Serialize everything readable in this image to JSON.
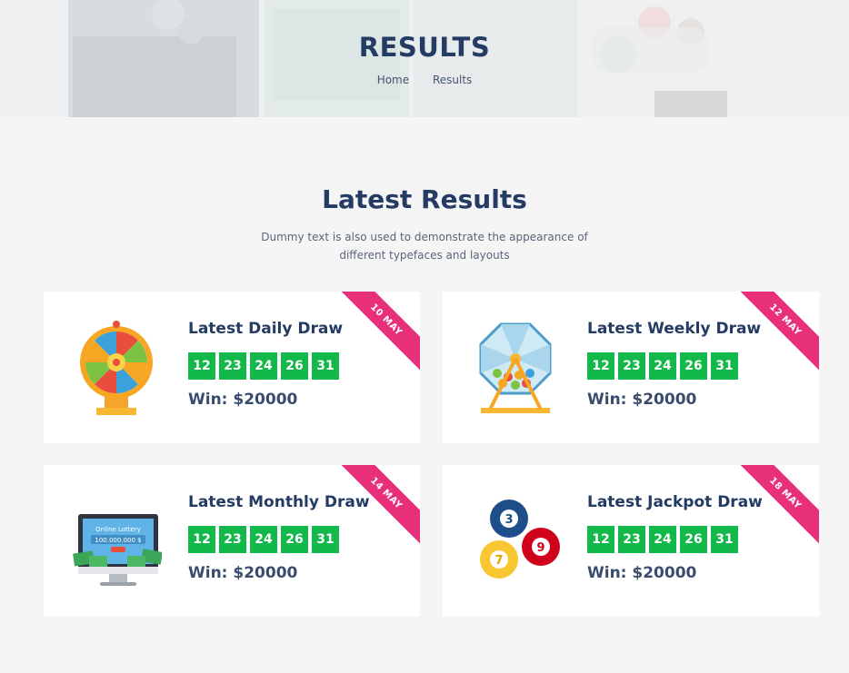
{
  "banner": {
    "title": "RESULTS",
    "breadcrumb": [
      "Home",
      "Results"
    ]
  },
  "section": {
    "title": "Latest Results",
    "description": "Dummy text is also used to demonstrate the appearance of different typefaces and layouts"
  },
  "cards": [
    {
      "title": "Latest Daily Draw",
      "date": "10 MAY",
      "numbers": [
        "12",
        "23",
        "24",
        "26",
        "31"
      ],
      "win": "Win: $20000",
      "image": "prize-wheel-icon"
    },
    {
      "title": "Latest Weekly Draw",
      "date": "12 MAY",
      "numbers": [
        "12",
        "23",
        "24",
        "26",
        "31"
      ],
      "win": "Win: $20000",
      "image": "lottery-drum-icon"
    },
    {
      "title": "Latest Monthly Draw",
      "date": "14 MAY",
      "numbers": [
        "12",
        "23",
        "24",
        "26",
        "31"
      ],
      "win": "Win: $20000",
      "image": "online-lottery-monitor-icon",
      "image_text": [
        "Online Lottery",
        "100.000.000 $"
      ]
    },
    {
      "title": "Latest Jackpot Draw",
      "date": "18 MAY",
      "numbers": [
        "12",
        "23",
        "24",
        "26",
        "31"
      ],
      "win": "Win: $20000",
      "image": "lottery-balls-icon",
      "balls": [
        "3",
        "9",
        "7"
      ]
    }
  ],
  "colors": {
    "accent_green": "#12b84a",
    "ribbon_pink": "#e8307a",
    "heading_navy": "#243b63",
    "background": "#f5f5f5"
  }
}
